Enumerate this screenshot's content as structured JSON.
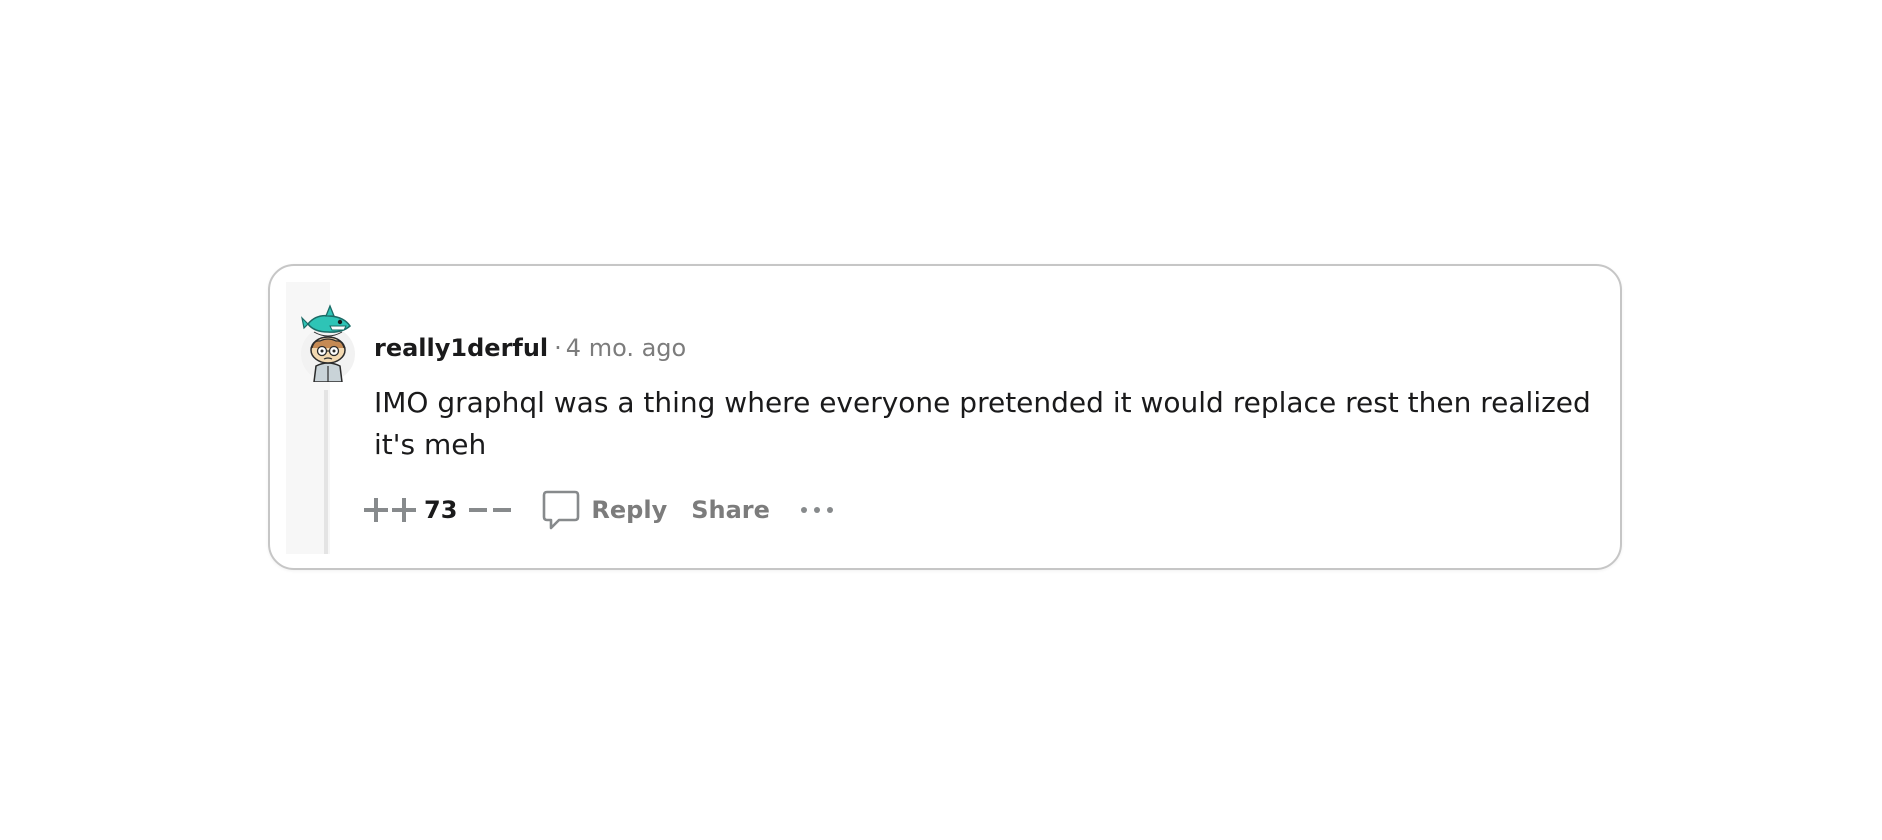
{
  "comment": {
    "username": "really1derful",
    "separator": "·",
    "age": "4 mo. ago",
    "body": "IMO graphql was a thing where everyone pretended it would replace rest then realized it's meh",
    "score": "73",
    "avatar_icon": "snoo-avatar-icon"
  },
  "actions": {
    "upvote_icon": "upvote-icon",
    "downvote_icon": "downvote-icon",
    "reply_icon": "comment-bubble-icon",
    "reply_label": "Reply",
    "share_label": "Share",
    "more_icon": "ellipsis-icon"
  },
  "colors": {
    "text_primary": "#1a1a1b",
    "text_secondary": "#7c7c7c",
    "icon_gray": "#878a8c",
    "avatar_accent": "#2ec4b6",
    "border": "#c6c6c6"
  }
}
